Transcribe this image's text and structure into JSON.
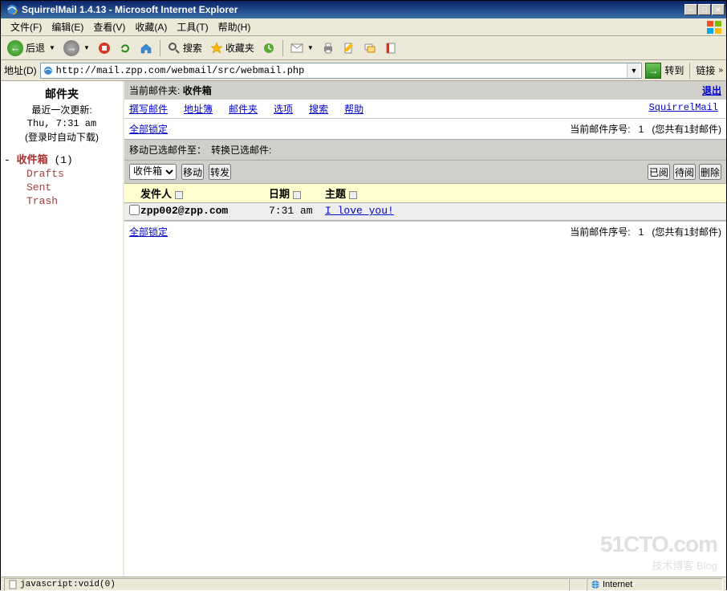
{
  "window": {
    "title": "SquirrelMail 1.4.13 - Microsoft Internet Explorer"
  },
  "menus": {
    "file": "文件(F)",
    "edit": "编辑(E)",
    "view": "查看(V)",
    "favorites": "收藏(A)",
    "tools": "工具(T)",
    "help": "帮助(H)"
  },
  "toolbar": {
    "back": "后退",
    "search": "搜索",
    "favs": "收藏夹"
  },
  "addressbar": {
    "label": "地址(D)",
    "url": "http://mail.zpp.com/webmail/src/webmail.php",
    "go": "转到",
    "links": "链接"
  },
  "sidebar": {
    "title": "邮件夹",
    "updated_label": "最近一次更新:",
    "updated_time": "Thu, 7:31 am",
    "refresh_note": "(登录时自动下载)",
    "inbox_prefix": "- ",
    "inbox": "收件箱",
    "inbox_count": "(1)",
    "drafts": "Drafts",
    "sent": "Sent",
    "trash": "Trash"
  },
  "rightpanel": {
    "current_folder_label": "当前邮件夹:",
    "current_folder": "收件箱",
    "signout": "退出",
    "nav": {
      "compose": "撰写邮件",
      "addresses": "地址簿",
      "folders": "邮件夹",
      "options": "选项",
      "search": "搜索",
      "help": "帮助",
      "brand": "SquirrelMail"
    },
    "toggle_all": "全部锁定",
    "paginator_label": "当前邮件序号:",
    "paginator_value": "1",
    "paginator_total": "(您共有1封邮件)",
    "move_label": "移动已选邮件至：",
    "move_select": "收件箱",
    "move_btn": "移动",
    "forward_btn": "转发",
    "transform_label": "转换已选邮件:",
    "read_btn": "已阅",
    "unread_btn": "待阅",
    "delete_btn": "删除",
    "cols": {
      "from": "发件人",
      "date": "日期",
      "subject": "主题"
    },
    "rows": [
      {
        "from": "zpp002@zpp.com",
        "date": "7:31 am",
        "subject": "I love you!"
      }
    ]
  },
  "status": {
    "left": "javascript:void(0)",
    "zone": "Internet"
  },
  "watermark": {
    "l1": "51CTO.com",
    "l2": "技术博客  Blog"
  }
}
